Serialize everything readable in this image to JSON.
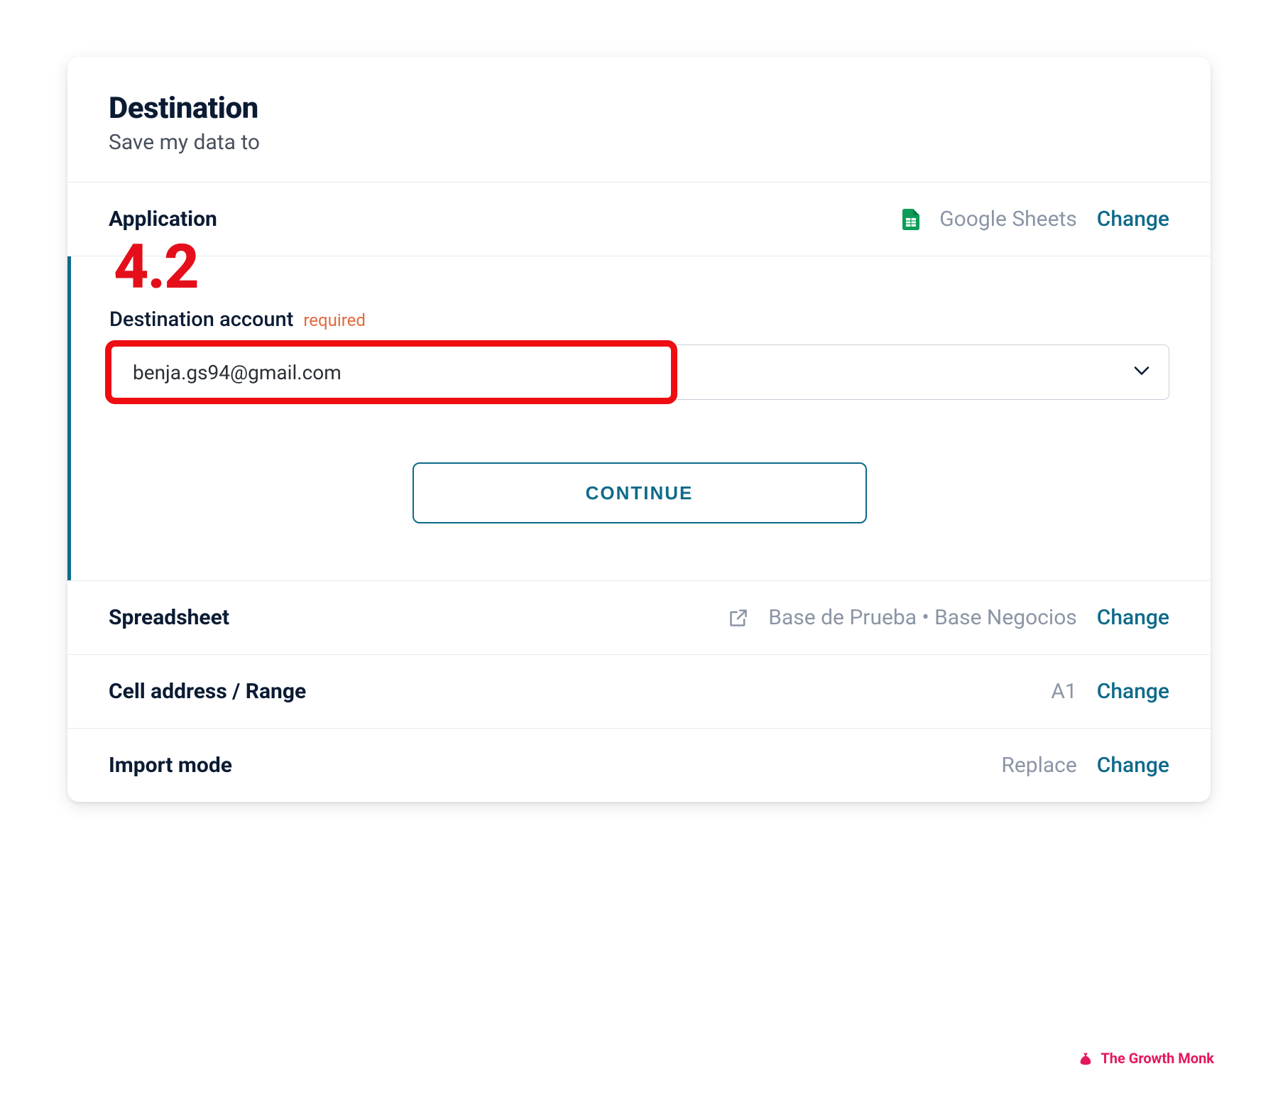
{
  "annotation": {
    "step_number": "4.2"
  },
  "header": {
    "title": "Destination",
    "subtitle": "Save my data to"
  },
  "rows": {
    "application": {
      "label": "Application",
      "value": "Google Sheets",
      "change": "Change"
    },
    "spreadsheet": {
      "label": "Spreadsheet",
      "value": "Base de Prueba • Base Negocios",
      "change": "Change"
    },
    "cell_range": {
      "label": "Cell address / Range",
      "value": "A1",
      "change": "Change"
    },
    "import_mode": {
      "label": "Import mode",
      "value": "Replace",
      "change": "Change"
    }
  },
  "account_section": {
    "label": "Destination account",
    "required": "required",
    "selected": "benja.gs94@gmail.com",
    "continue": "CONTINUE"
  },
  "watermark": {
    "label": "The Growth Monk"
  }
}
